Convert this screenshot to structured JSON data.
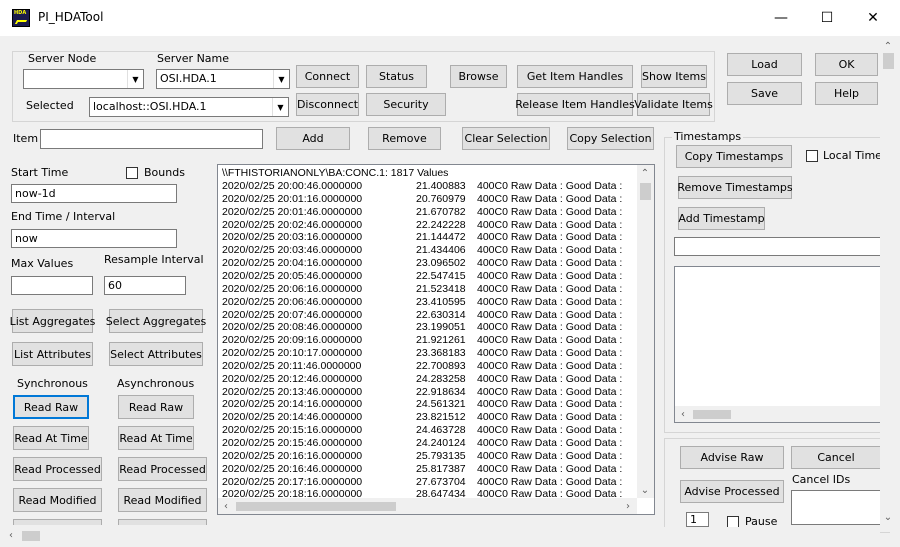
{
  "window": {
    "title": "PI_HDATool",
    "icon_text": "HDA",
    "minimize_glyph": "—",
    "maximize_glyph": "☐",
    "close_glyph": "✕"
  },
  "server": {
    "node_label": "Server Node",
    "node_value": "",
    "name_label": "Server Name",
    "name_value": "OSI.HDA.1",
    "selected_label": "Selected",
    "selected_value": "localhost::OSI.HDA.1",
    "connect": "Connect",
    "disconnect": "Disconnect",
    "status": "Status",
    "security": "Security",
    "browse": "Browse",
    "get_item_handles": "Get Item Handles",
    "release_item_handles": "Release Item Handles",
    "show_items": "Show Items",
    "validate_items": "Validate Items"
  },
  "file": {
    "load": "Load",
    "save": "Save",
    "ok": "OK",
    "help": "Help"
  },
  "item_bar": {
    "item_label": "Item",
    "item_value": "",
    "add": "Add",
    "remove": "Remove",
    "clear_selection": "Clear Selection",
    "copy_selection": "Copy Selection"
  },
  "params": {
    "start_time_label": "Start Time",
    "start_time_value": "now-1d",
    "bounds_label": "Bounds",
    "end_time_label": "End Time / Interval",
    "end_time_value": "now",
    "max_values_label": "Max Values",
    "max_values_value": "",
    "resample_label": "Resample Interval",
    "resample_value": "60"
  },
  "actions": {
    "list_aggregates": "List Aggregates",
    "select_aggregates": "Select Aggregates",
    "list_attributes": "List Attributes",
    "select_attributes": "Select Attributes",
    "sync_label": "Synchronous",
    "async_label": "Asynchronous",
    "sync_read_raw": "Read Raw",
    "async_read_raw": "Read Raw",
    "sync_read_at_time": "Read At Time",
    "async_read_at_time": "Read At Time",
    "sync_read_processed": "Read Processed",
    "async_read_processed": "Read Processed",
    "sync_read_modified": "Read Modified",
    "async_read_modified": "Read Modified"
  },
  "results": {
    "header": "\\\\FTHISTORIANONLY\\BA:CONC.1:  1817  Values",
    "rows": [
      {
        "t": "2020/02/25 20:00:46.0000000",
        "v": "21.400883",
        "q": "400C0 Raw Data :  Good Data :"
      },
      {
        "t": "2020/02/25 20:01:16.0000000",
        "v": "20.760979",
        "q": "400C0 Raw Data :  Good Data :"
      },
      {
        "t": "2020/02/25 20:01:46.0000000",
        "v": "21.670782",
        "q": "400C0 Raw Data :  Good Data :"
      },
      {
        "t": "2020/02/25 20:02:46.0000000",
        "v": "22.242228",
        "q": "400C0 Raw Data :  Good Data :"
      },
      {
        "t": "2020/02/25 20:03:16.0000000",
        "v": "21.144472",
        "q": "400C0 Raw Data :  Good Data :"
      },
      {
        "t": "2020/02/25 20:03:46.0000000",
        "v": "21.434406",
        "q": "400C0 Raw Data :  Good Data :"
      },
      {
        "t": "2020/02/25 20:04:16.0000000",
        "v": "23.096502",
        "q": "400C0 Raw Data :  Good Data :"
      },
      {
        "t": "2020/02/25 20:05:46.0000000",
        "v": "22.547415",
        "q": "400C0 Raw Data :  Good Data :"
      },
      {
        "t": "2020/02/25 20:06:16.0000000",
        "v": "21.523418",
        "q": "400C0 Raw Data :  Good Data :"
      },
      {
        "t": "2020/02/25 20:06:46.0000000",
        "v": "23.410595",
        "q": "400C0 Raw Data :  Good Data :"
      },
      {
        "t": "2020/02/25 20:07:46.0000000",
        "v": "22.630314",
        "q": "400C0 Raw Data :  Good Data :"
      },
      {
        "t": "2020/02/25 20:08:46.0000000",
        "v": "23.199051",
        "q": "400C0 Raw Data :  Good Data :"
      },
      {
        "t": "2020/02/25 20:09:16.0000000",
        "v": "21.921261",
        "q": "400C0 Raw Data :  Good Data :"
      },
      {
        "t": "2020/02/25 20:10:17.0000000",
        "v": "23.368183",
        "q": "400C0 Raw Data :  Good Data :"
      },
      {
        "t": "2020/02/25 20:11:46.0000000",
        "v": "22.700893",
        "q": "400C0 Raw Data :  Good Data :"
      },
      {
        "t": "2020/02/25 20:12:46.0000000",
        "v": "24.283258",
        "q": "400C0 Raw Data :  Good Data :"
      },
      {
        "t": "2020/02/25 20:13:46.0000000",
        "v": "22.918634",
        "q": "400C0 Raw Data :  Good Data :"
      },
      {
        "t": "2020/02/25 20:14:16.0000000",
        "v": "24.561321",
        "q": "400C0 Raw Data :  Good Data :"
      },
      {
        "t": "2020/02/25 20:14:46.0000000",
        "v": "23.821512",
        "q": "400C0 Raw Data :  Good Data :"
      },
      {
        "t": "2020/02/25 20:15:16.0000000",
        "v": "24.463728",
        "q": "400C0 Raw Data :  Good Data :"
      },
      {
        "t": "2020/02/25 20:15:46.0000000",
        "v": "24.240124",
        "q": "400C0 Raw Data :  Good Data :"
      },
      {
        "t": "2020/02/25 20:16:16.0000000",
        "v": "25.793135",
        "q": "400C0 Raw Data :  Good Data :"
      },
      {
        "t": "2020/02/25 20:16:46.0000000",
        "v": "25.817387",
        "q": "400C0 Raw Data :  Good Data :"
      },
      {
        "t": "2020/02/25 20:17:16.0000000",
        "v": "27.673704",
        "q": "400C0 Raw Data :  Good Data :"
      },
      {
        "t": "2020/02/25 20:18:16.0000000",
        "v": "28.647434",
        "q": "400C0 Raw Data :  Good Data :"
      }
    ]
  },
  "timestamps": {
    "group_label": "Timestamps",
    "copy": "Copy Timestamps",
    "local_time_label": "Local Time",
    "remove": "Remove Timestamps",
    "add": "Add Timestamp",
    "input_value": ""
  },
  "advise": {
    "advise_raw": "Advise Raw",
    "cancel": "Cancel",
    "advise_processed": "Advise Processed",
    "cancel_ids_label": "Cancel IDs",
    "count_value": "1",
    "pause_label": "Pause"
  },
  "icons": {
    "dropdown": "▼",
    "up": "▲",
    "down": "▼",
    "left": "◀",
    "right": "▶",
    "chevron_up": "⌃",
    "chevron_down": "⌄",
    "chevron_left": "‹",
    "chevron_right": "›"
  }
}
